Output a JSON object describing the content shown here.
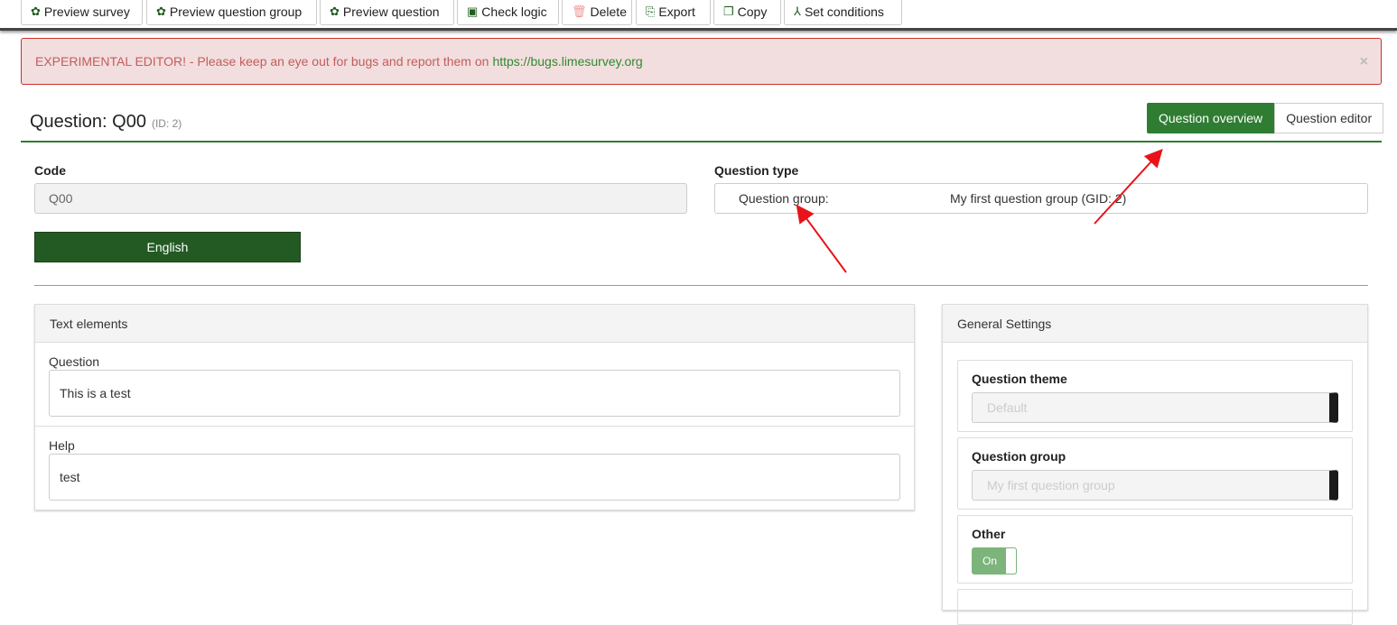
{
  "toolbar": [
    {
      "label": "Preview survey",
      "icon": "gear-icon",
      "glyph": "✿"
    },
    {
      "label": "Preview question group",
      "icon": "gear-icon",
      "glyph": "✿"
    },
    {
      "label": "Preview question",
      "icon": "gear-icon",
      "glyph": "✿"
    },
    {
      "label": "Check logic",
      "icon": "qa-icon",
      "glyph": "▣"
    },
    {
      "label": "Delete",
      "icon": "trash-icon",
      "glyph": "🗑"
    },
    {
      "label": "Export",
      "icon": "export-icon",
      "glyph": "⎘"
    },
    {
      "label": "Copy",
      "icon": "copy-icon",
      "glyph": "❐"
    },
    {
      "label": "Set conditions",
      "icon": "conditions-icon",
      "glyph": "⅄"
    }
  ],
  "alert": {
    "text": "EXPERIMENTAL EDITOR! - Please keep an eye out for bugs and report them on",
    "link": "https://bugs.limesurvey.org",
    "close": "×"
  },
  "header": {
    "title": "Question: Q00",
    "id": "(ID: 2)"
  },
  "tabs": [
    "Question overview",
    "Question editor"
  ],
  "code": {
    "label": "Code",
    "value": "Q00"
  },
  "qtype": {
    "label": "Question type",
    "key": "Question group:",
    "value": "My first question group (GID: 2)"
  },
  "language": "English",
  "text_elements": {
    "title": "Text elements",
    "question_label": "Question",
    "question_value": "This is a test",
    "help_label": "Help",
    "help_value": "test"
  },
  "general": {
    "title": "General Settings",
    "theme_label": "Question theme",
    "theme_value": "Default",
    "group_label": "Question group",
    "group_value": "My first question group",
    "other_label": "Other",
    "other_value": "On"
  },
  "colors": {
    "accent": "#2f7d32",
    "arrow": "#e8141a"
  }
}
